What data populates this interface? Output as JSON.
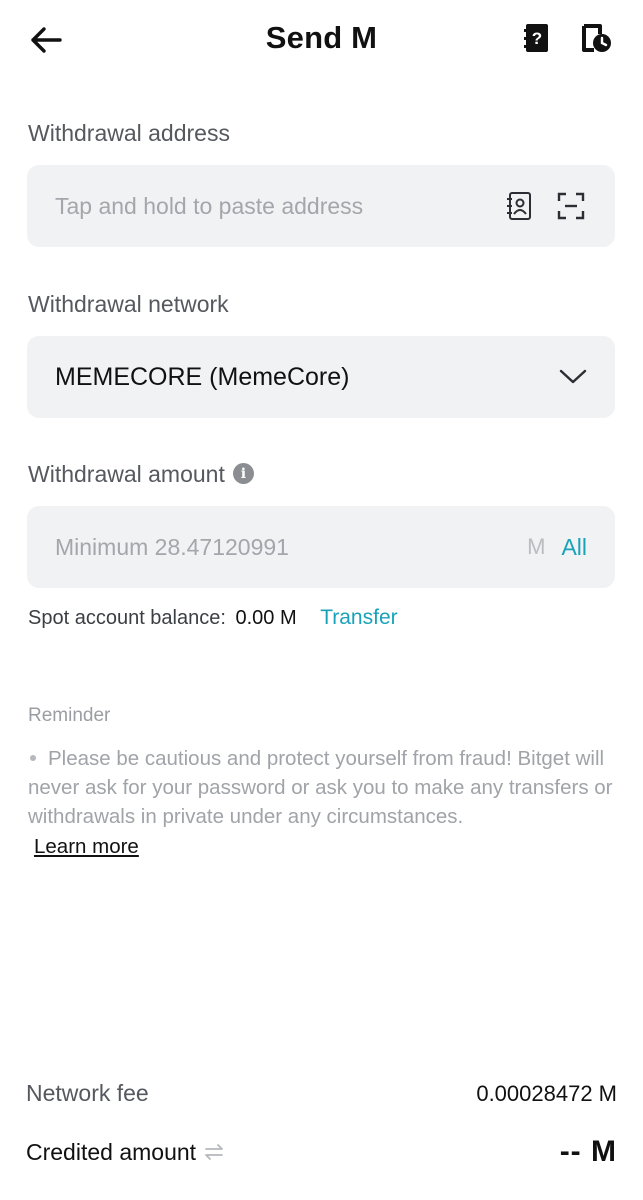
{
  "header": {
    "title": "Send M",
    "back_icon": "arrow-left-icon",
    "help_icon": "help-book-icon",
    "history_icon": "history-clock-icon"
  },
  "address": {
    "label": "Withdrawal address",
    "placeholder": "Tap and hold to paste address",
    "contacts_icon": "address-book-icon",
    "scan_icon": "scan-qr-icon"
  },
  "network": {
    "label": "Withdrawal network",
    "selected": "MEMECORE (MemeCore)",
    "chevron_icon": "chevron-down-icon"
  },
  "amount": {
    "label": "Withdrawal amount",
    "info_icon": "info-icon",
    "placeholder": "Minimum 28.47120991",
    "unit": "M",
    "all_label": "All"
  },
  "balance": {
    "label": "Spot account balance:",
    "value": "0.00 M",
    "transfer_label": "Transfer"
  },
  "reminder": {
    "title": "Reminder",
    "text": "Please be cautious and protect yourself from fraud! Bitget will never ask for your password or ask you to make any transfers or withdrawals in private under any circumstances.",
    "learn_more": "Learn more"
  },
  "summary": {
    "fee_label": "Network fee",
    "fee_value": "0.00028472 M",
    "credited_label": "Credited amount",
    "credited_value": "-- M",
    "swap_icon": "swap-arrows-icon"
  },
  "colors": {
    "accent": "#1aa3b8",
    "field_bg": "#f1f2f4",
    "muted_text": "#a0a3a8"
  }
}
